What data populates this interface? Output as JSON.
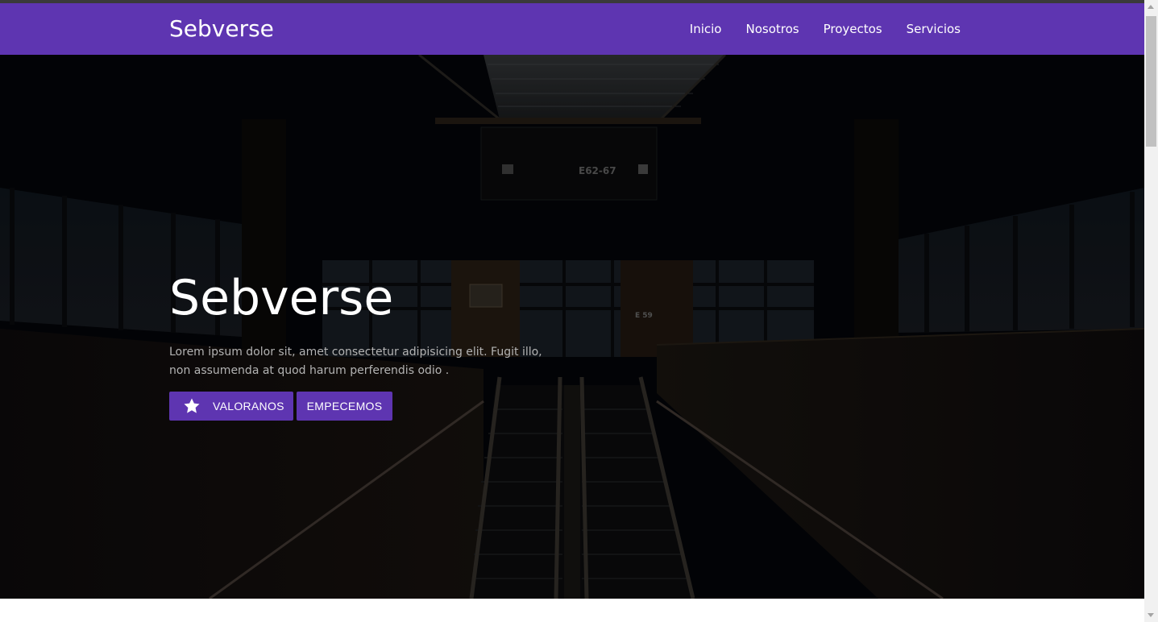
{
  "navbar": {
    "brand": "Sebverse",
    "links": [
      {
        "label": "Inicio"
      },
      {
        "label": "Nosotros"
      },
      {
        "label": "Proyectos"
      },
      {
        "label": "Servicios"
      }
    ],
    "background": "#5e35b1"
  },
  "hero": {
    "title": "Sebverse",
    "text": "Lorem ipsum dolor sit, amet consectetur adipisicing elit. Fugit illo, non assumenda at quod harum perferendis odio .",
    "buttons": {
      "rate": {
        "label": "VALORANOS",
        "icon": "star-icon"
      },
      "start": {
        "label": "EMPECEMOS"
      }
    },
    "sign": {
      "label": "E62-67"
    },
    "sign_small": {
      "label": "E 59"
    }
  }
}
